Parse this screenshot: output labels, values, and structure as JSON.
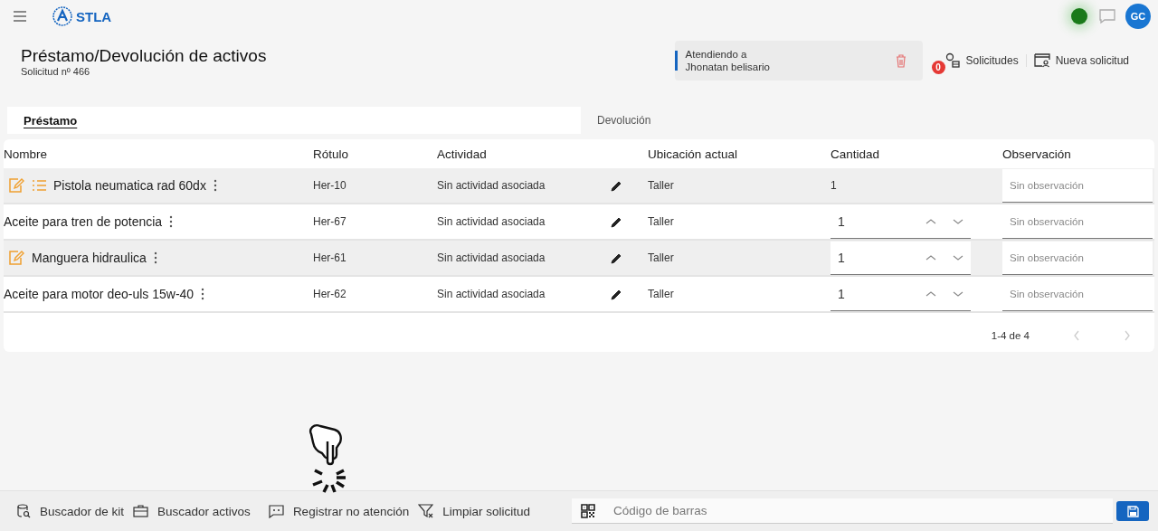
{
  "app": {
    "name": "STLA",
    "online": true,
    "avatar": "GC"
  },
  "page": {
    "title": "Préstamo/Devolución de activos",
    "subtitle": "Solicitud nº 466"
  },
  "attending": {
    "label": "Atendiendo a",
    "name": "Jhonatan belisario"
  },
  "actions": [
    {
      "kind": "requests",
      "label": "Solicitudes",
      "badge": "0"
    },
    {
      "kind": "new",
      "label": "Nueva solicitud"
    }
  ],
  "tabs": [
    {
      "label": "Préstamo",
      "selected": true
    },
    {
      "label": "Devolución",
      "selected": false
    }
  ],
  "table": {
    "columns": [
      "Nombre",
      "Rótulo",
      "Actividad",
      "Ubicación actual",
      "Cantidad",
      "Observación"
    ],
    "rows": [
      {
        "name": "Pistola neumatica rad 60dx",
        "has_note": true,
        "has_list": true,
        "label": "Her-10",
        "activity": "Sin actividad asociada",
        "location": "Taller",
        "quantity": "1",
        "quantity_editable": false,
        "observation_placeholder": "Sin observación"
      },
      {
        "name": "Aceite para tren de potencia",
        "has_note": false,
        "has_list": false,
        "label": "Her-67",
        "activity": "Sin actividad asociada",
        "location": "Taller",
        "quantity": "1",
        "quantity_editable": true,
        "observation_placeholder": "Sin observación"
      },
      {
        "name": "Manguera hidraulica",
        "has_note": true,
        "has_list": false,
        "label": "Her-61",
        "activity": "Sin actividad asociada",
        "location": "Taller",
        "quantity": "1",
        "quantity_editable": true,
        "observation_placeholder": "Sin observación"
      },
      {
        "name": "Aceite para motor deo-uls 15w-40",
        "has_note": false,
        "has_list": false,
        "label": "Her-62",
        "activity": "Sin actividad asociada",
        "location": "Taller",
        "quantity": "1",
        "quantity_editable": true,
        "observation_placeholder": "Sin observación"
      }
    ],
    "pagination": "1-4 de 4"
  },
  "toolbar": [
    {
      "kind": "kit",
      "label": "Buscador de kit"
    },
    {
      "kind": "assets",
      "label": "Buscador activos"
    },
    {
      "kind": "no-attention",
      "label": "Registrar no atención"
    },
    {
      "kind": "clear",
      "label": "Limpiar solicitud"
    }
  ],
  "barcode": {
    "placeholder": "Código de barras"
  }
}
